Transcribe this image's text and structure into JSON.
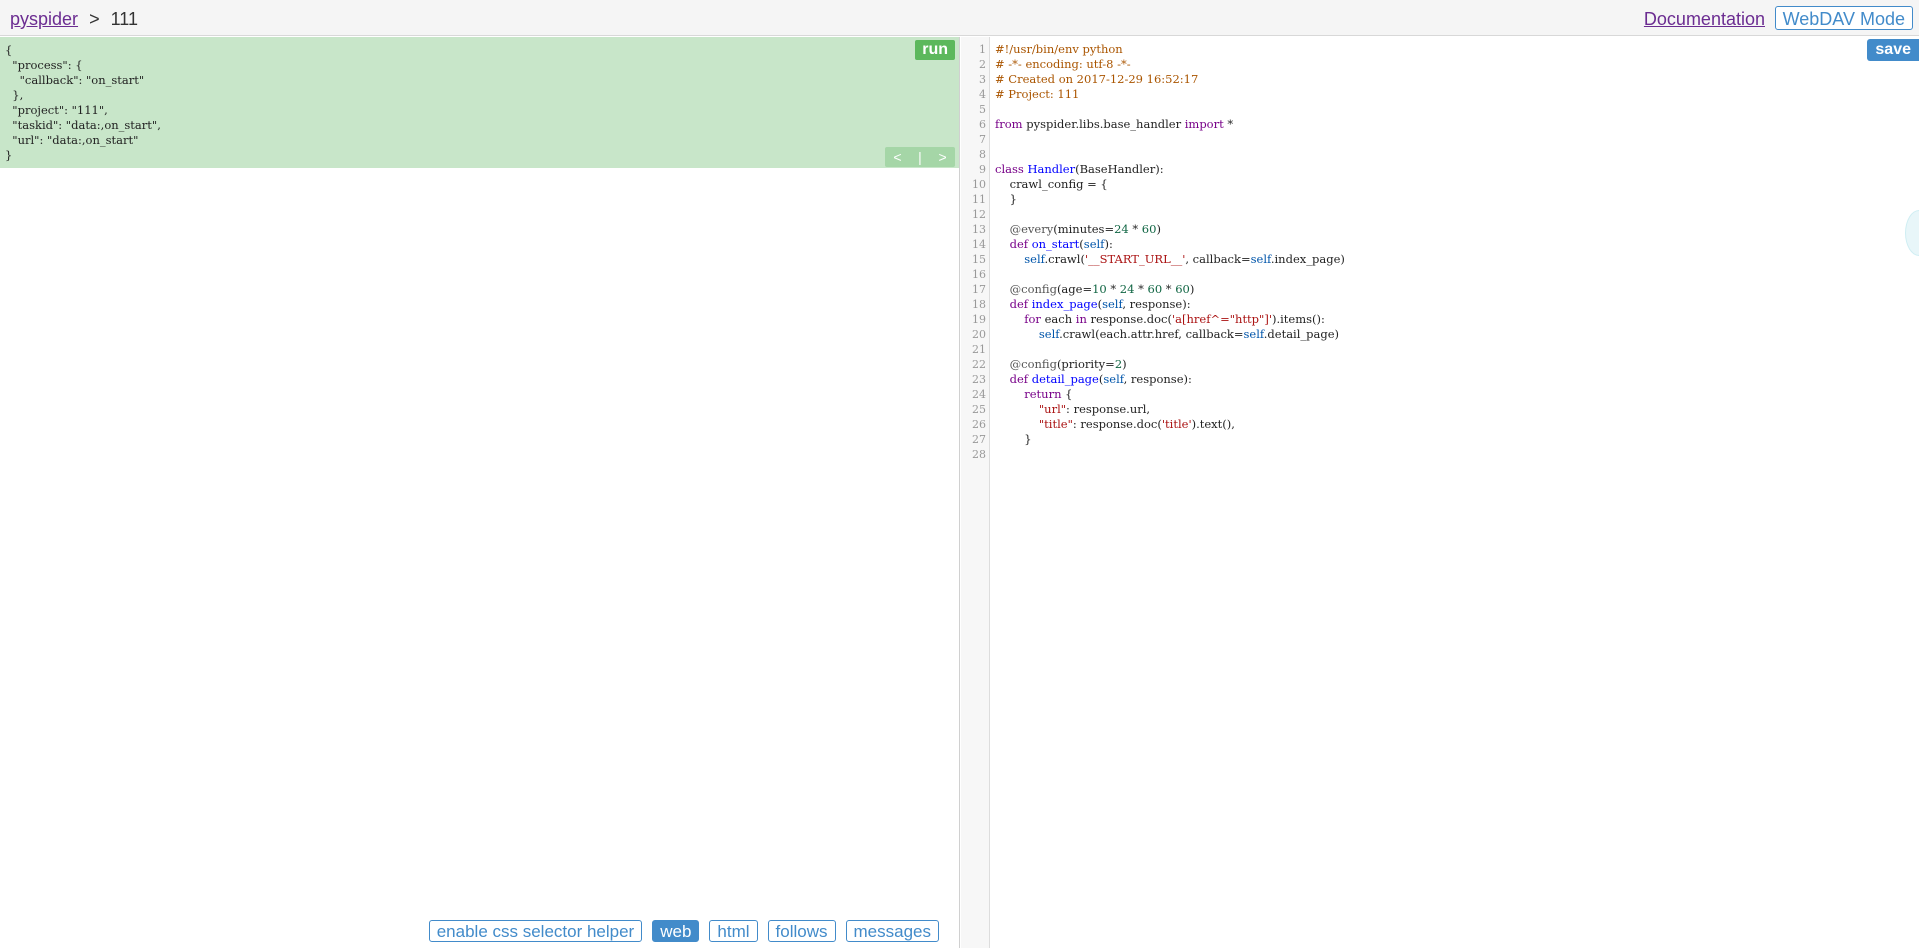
{
  "header": {
    "home_link": "pyspider",
    "separator": ">",
    "project_name": "111",
    "doc_link": "Documentation",
    "webdav_button": "WebDAV Mode"
  },
  "task_panel": {
    "run_button": "run",
    "prev_button": "<",
    "divider": "|",
    "next_button": ">",
    "json_lines": [
      "{",
      "  \"process\": {",
      "    \"callback\": \"on_start\"",
      "  },",
      "  \"project\": \"111\",",
      "  \"taskid\": \"data:,on_start\",",
      "  \"url\": \"data:,on_start\"",
      "}"
    ]
  },
  "tabs": {
    "css_helper": "enable css selector helper",
    "web": "web",
    "html": "html",
    "follows": "follows",
    "messages": "messages",
    "active": "web"
  },
  "editor": {
    "save_button": "save",
    "line_numbers": [
      "1",
      "2",
      "3",
      "4",
      "5",
      "6",
      "7",
      "8",
      "9",
      "10",
      "11",
      "12",
      "13",
      "14",
      "15",
      "16",
      "17",
      "18",
      "19",
      "20",
      "21",
      "22",
      "23",
      "24",
      "25",
      "26",
      "27",
      "28"
    ]
  },
  "colors": {
    "task_bg": "#c8e6c9",
    "run_green": "#5cb85c",
    "accent_blue": "#428bca",
    "link_purple": "#6b2c91"
  }
}
